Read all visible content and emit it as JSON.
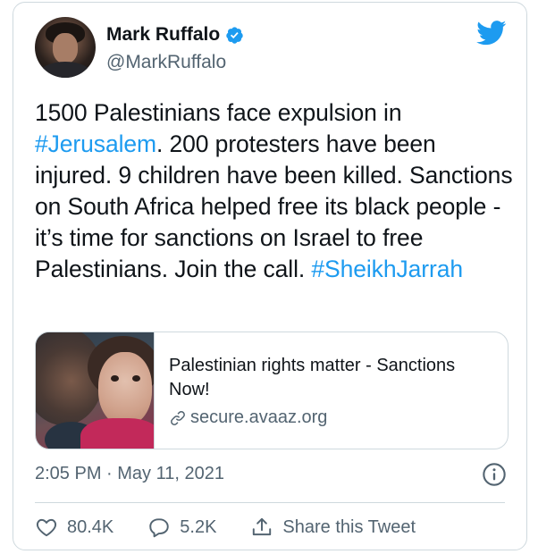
{
  "author": {
    "display_name": "Mark Ruffalo",
    "handle": "@MarkRuffalo",
    "verified": true,
    "avatar_icon": "profile-photo"
  },
  "brand": {
    "icon": "twitter-bird-icon",
    "color": "#1d9bf0"
  },
  "tweet": {
    "segments": [
      {
        "text": "1500 Palestinians face expulsion in ",
        "type": "text"
      },
      {
        "text": "#Jerusalem",
        "type": "hashtag"
      },
      {
        "text": ". 200 protesters have been injured. 9 children have been killed. Sanctions on South Africa helped free its black people - it’s time for sanctions on Israel to free Palestinians. Join the call. ",
        "type": "text"
      },
      {
        "text": "#SheikhJarrah",
        "type": "hashtag"
      }
    ]
  },
  "link_card": {
    "title": "Palestinian rights matter - Sanctions Now!",
    "domain": "secure.avaaz.org"
  },
  "meta": {
    "timestamp": "2:05 PM · May 11, 2021"
  },
  "actions": {
    "likes": "80.4K",
    "replies": "5.2K",
    "share_label": "Share this Tweet"
  },
  "colors": {
    "text": "#0f1419",
    "muted": "#536471",
    "accent": "#1d9bf0",
    "border": "#cfd9de"
  }
}
